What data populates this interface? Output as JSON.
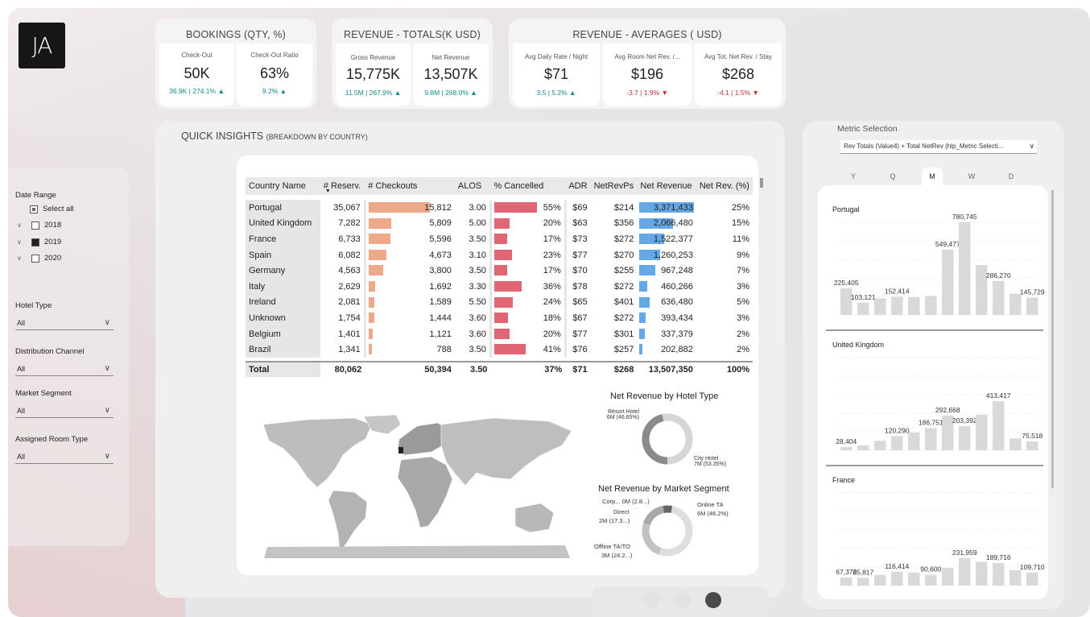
{
  "logo": {
    "text": "JA"
  },
  "kpis": {
    "bookings": {
      "title": "BOOKINGS (QTY, %)",
      "items": [
        {
          "label": "Check-Out",
          "value": "50K",
          "variance": "36.9K | 274.1%",
          "dir": "up"
        },
        {
          "label": "Check-Out Ratio",
          "value": "63%",
          "variance": "9.2%",
          "dir": "up"
        }
      ]
    },
    "revenue_totals": {
      "title": "REVENUE - TOTALS(K USD)",
      "items": [
        {
          "label": "Gross Revenue",
          "value": "15,775K",
          "variance": "11.5M | 267.9%",
          "dir": "up"
        },
        {
          "label": "Net Revenue",
          "value": "13,507K",
          "variance": "9.8M | 268.0%",
          "dir": "up"
        }
      ]
    },
    "revenue_averages": {
      "title": "REVENUE - AVERAGES ( USD)",
      "items": [
        {
          "label": "Avg Daily Rate / Night",
          "value": "$71",
          "variance": "3.5 | 5.2%",
          "dir": "up"
        },
        {
          "label": "Avg Room Net Rev. /...",
          "value": "$196",
          "variance": "-3.7 | 1.9%",
          "dir": "down"
        },
        {
          "label": "Avg Tot. Net Rev. / Stay",
          "value": "$268",
          "variance": "-4.1 | 1.5%",
          "dir": "down"
        }
      ]
    }
  },
  "filters": {
    "date_range": {
      "label": "Date Range",
      "select_all": "Select all",
      "years": [
        "2018",
        "2019",
        "2020"
      ]
    },
    "hotel_type": {
      "label": "Hotel Type",
      "value": "All"
    },
    "distribution_channel": {
      "label": "Distribution Channel",
      "value": "All"
    },
    "market_segment": {
      "label": "Market Segment",
      "value": "All"
    },
    "assigned_room_type": {
      "label": "Assigned Room Type",
      "value": "All"
    }
  },
  "insights": {
    "title": "QUICK INSIGHTS",
    "subtitle": "(BREAKDOWN BY COUNTRY)"
  },
  "table": {
    "columns": [
      "Country Name",
      "# Reserv.",
      "# Checkouts",
      "ALOS",
      "% Cancelled",
      "ADR",
      "NetRevPs",
      "Net Revenue",
      "Net Rev. (%)"
    ],
    "rows": [
      {
        "country": "Portugal",
        "reserv": "35,067",
        "checkouts": "15,812",
        "ck_frac": 1.0,
        "alos": "3.00",
        "cancelled": "55%",
        "cn_frac": 0.55,
        "adr": "$69",
        "netrevps": "$214",
        "netrev": "3,371,433",
        "nr_frac": 1.0,
        "pct": "25%"
      },
      {
        "country": "United Kingdom",
        "reserv": "7,282",
        "checkouts": "5,809",
        "ck_frac": 0.367,
        "alos": "5.00",
        "cancelled": "20%",
        "cn_frac": 0.2,
        "adr": "$63",
        "netrevps": "$356",
        "netrev": "2,066,480",
        "nr_frac": 0.613,
        "pct": "15%"
      },
      {
        "country": "France",
        "reserv": "6,733",
        "checkouts": "5,596",
        "ck_frac": 0.354,
        "alos": "3.50",
        "cancelled": "17%",
        "cn_frac": 0.17,
        "adr": "$73",
        "netrevps": "$272",
        "netrev": "1,522,377",
        "nr_frac": 0.452,
        "pct": "11%"
      },
      {
        "country": "Spain",
        "reserv": "6,082",
        "checkouts": "4,673",
        "ck_frac": 0.296,
        "alos": "3.10",
        "cancelled": "23%",
        "cn_frac": 0.23,
        "adr": "$77",
        "netrevps": "$270",
        "netrev": "1,260,253",
        "nr_frac": 0.374,
        "pct": "9%"
      },
      {
        "country": "Germany",
        "reserv": "4,563",
        "checkouts": "3,800",
        "ck_frac": 0.24,
        "alos": "3.50",
        "cancelled": "17%",
        "cn_frac": 0.17,
        "adr": "$70",
        "netrevps": "$255",
        "netrev": "967,248",
        "nr_frac": 0.287,
        "pct": "7%"
      },
      {
        "country": "Italy",
        "reserv": "2,629",
        "checkouts": "1,692",
        "ck_frac": 0.107,
        "alos": "3.30",
        "cancelled": "36%",
        "cn_frac": 0.36,
        "adr": "$78",
        "netrevps": "$272",
        "netrev": "460,266",
        "nr_frac": 0.137,
        "pct": "3%"
      },
      {
        "country": "Ireland",
        "reserv": "2,081",
        "checkouts": "1,589",
        "ck_frac": 0.1,
        "alos": "5.50",
        "cancelled": "24%",
        "cn_frac": 0.24,
        "adr": "$65",
        "netrevps": "$401",
        "netrev": "636,480",
        "nr_frac": 0.189,
        "pct": "5%"
      },
      {
        "country": "Unknown",
        "reserv": "1,754",
        "checkouts": "1,444",
        "ck_frac": 0.091,
        "alos": "3.60",
        "cancelled": "18%",
        "cn_frac": 0.18,
        "adr": "$67",
        "netrevps": "$272",
        "netrev": "393,434",
        "nr_frac": 0.117,
        "pct": "3%"
      },
      {
        "country": "Belgium",
        "reserv": "1,401",
        "checkouts": "1,121",
        "ck_frac": 0.071,
        "alos": "3.60",
        "cancelled": "20%",
        "cn_frac": 0.2,
        "adr": "$77",
        "netrevps": "$301",
        "netrev": "337,379",
        "nr_frac": 0.1,
        "pct": "2%"
      },
      {
        "country": "Brazil",
        "reserv": "1,341",
        "checkouts": "788",
        "ck_frac": 0.05,
        "alos": "3.50",
        "cancelled": "41%",
        "cn_frac": 0.41,
        "adr": "$76",
        "netrevps": "$257",
        "netrev": "202,882",
        "nr_frac": 0.06,
        "pct": "2%"
      }
    ],
    "total": {
      "country": "Total",
      "reserv": "80,062",
      "checkouts": "50,394",
      "alos": "3.50",
      "cancelled": "37%",
      "adr": "$71",
      "netrevps": "$268",
      "netrev": "13,507,350",
      "pct": "100%"
    }
  },
  "donut_hotel": {
    "title": "Net Revenue by Hotel Type",
    "labels": [
      {
        "name": "Resort Hotel",
        "value": "6M (46.65%)"
      },
      {
        "name": "City Hotel",
        "value": "7M (53.35%)"
      }
    ]
  },
  "donut_segment": {
    "title": "Net Revenue by Market Segment",
    "labels": [
      {
        "text": "Corp... 0M (2.8...)"
      },
      {
        "text": "Direct"
      },
      {
        "text": "2M (17.3...)"
      },
      {
        "text": "Offline TA/TO"
      },
      {
        "text": "3M (24.2...)"
      },
      {
        "text": "Online TA"
      },
      {
        "text": "6M (46.2%)"
      }
    ]
  },
  "metric": {
    "title": "Metric Selection",
    "dropdown": "Rev Totals (Value4) + Total NetRev (hlp_Metric Selecti...",
    "periods": [
      "Y",
      "Q",
      "M",
      "W",
      "D"
    ],
    "active_period": "M"
  },
  "chart_data": [
    {
      "type": "bar",
      "title": "Portugal",
      "values": [
        225405,
        103121,
        140000,
        152414,
        150000,
        160000,
        549477,
        780745,
        420000,
        286270,
        180000,
        145729
      ],
      "labels": [
        "225,405",
        "103,121",
        "",
        "152,414",
        "",
        "",
        "549,477",
        "780,745",
        "",
        "286,270",
        "",
        "145,729"
      ]
    },
    {
      "type": "bar",
      "title": "United Kingdom",
      "values": [
        28404,
        40000,
        80000,
        120290,
        150000,
        186751,
        292668,
        203392,
        300000,
        413417,
        100000,
        75518
      ],
      "labels": [
        "28,404",
        "",
        "",
        "120,290",
        "",
        "186,751",
        "292,668",
        "203,392",
        "",
        "413,417",
        "",
        "75,518"
      ]
    },
    {
      "type": "bar",
      "title": "France",
      "values": [
        67372,
        65817,
        90000,
        116414,
        110000,
        90600,
        150000,
        231959,
        200000,
        189716,
        130000,
        109710
      ],
      "labels": [
        "67,372",
        "65,817",
        "",
        "116,414",
        "",
        "90,600",
        "",
        "231,959",
        "",
        "189,716",
        "",
        "109,710"
      ]
    }
  ],
  "colors": {
    "checkout_bar": "#eea98a",
    "cancel_bar": "#e06673",
    "netrev_bar": "#65a8e8",
    "kpi_up": "#138a8a",
    "kpi_down": "#c03030",
    "column": "#d9d9d9"
  }
}
